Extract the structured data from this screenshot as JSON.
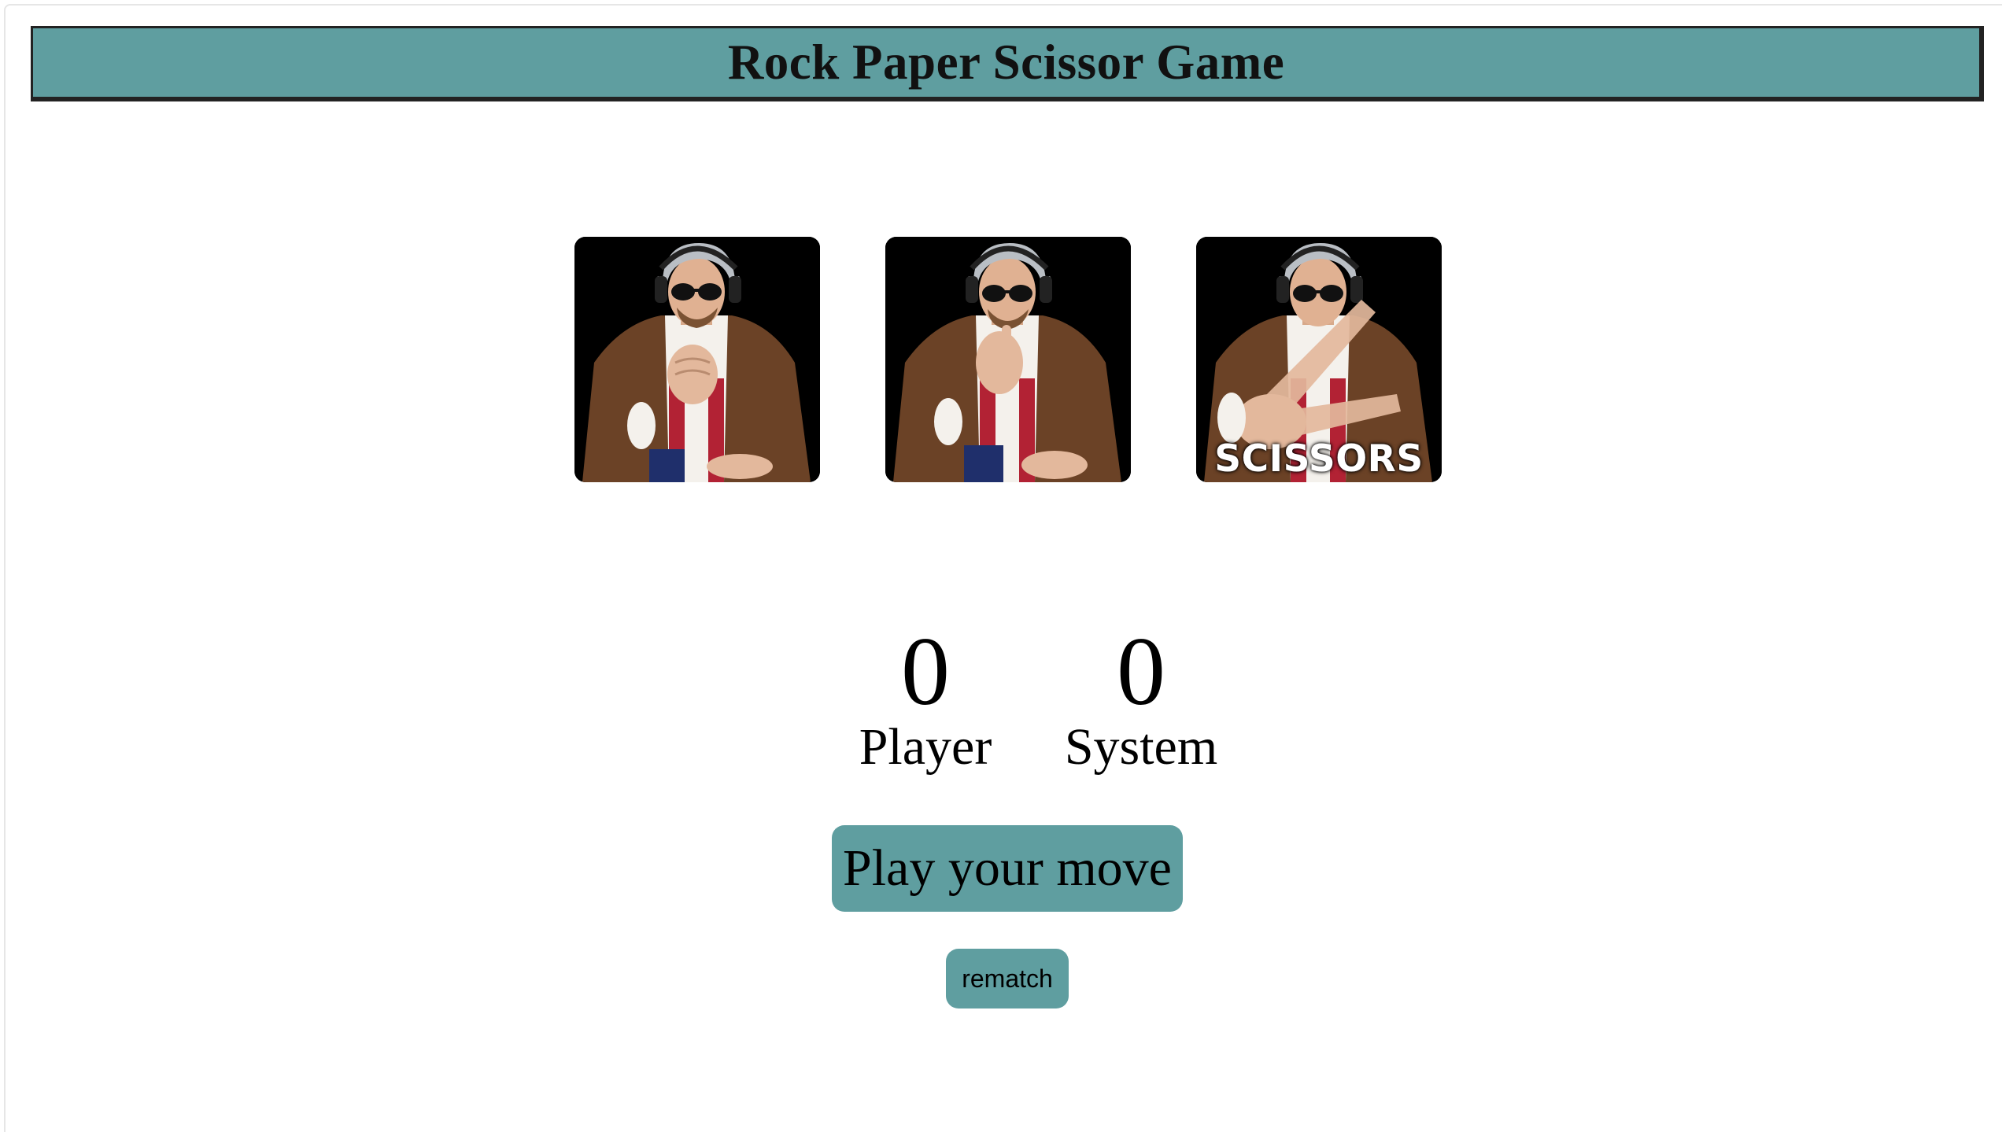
{
  "header": {
    "title": "Rock Paper Scissor Game"
  },
  "choices": [
    {
      "id": "rock",
      "caption": ""
    },
    {
      "id": "paper",
      "caption": ""
    },
    {
      "id": "scissors",
      "caption": "SCISSORS"
    }
  ],
  "scores": {
    "player": {
      "value": "0",
      "label": "Player"
    },
    "system": {
      "value": "0",
      "label": "System"
    }
  },
  "buttons": {
    "play_label": "Play your move",
    "rematch_label": "rematch"
  },
  "colors": {
    "accent": "#5f9ea0",
    "header_border": "#222222",
    "card_background": "#000000"
  }
}
